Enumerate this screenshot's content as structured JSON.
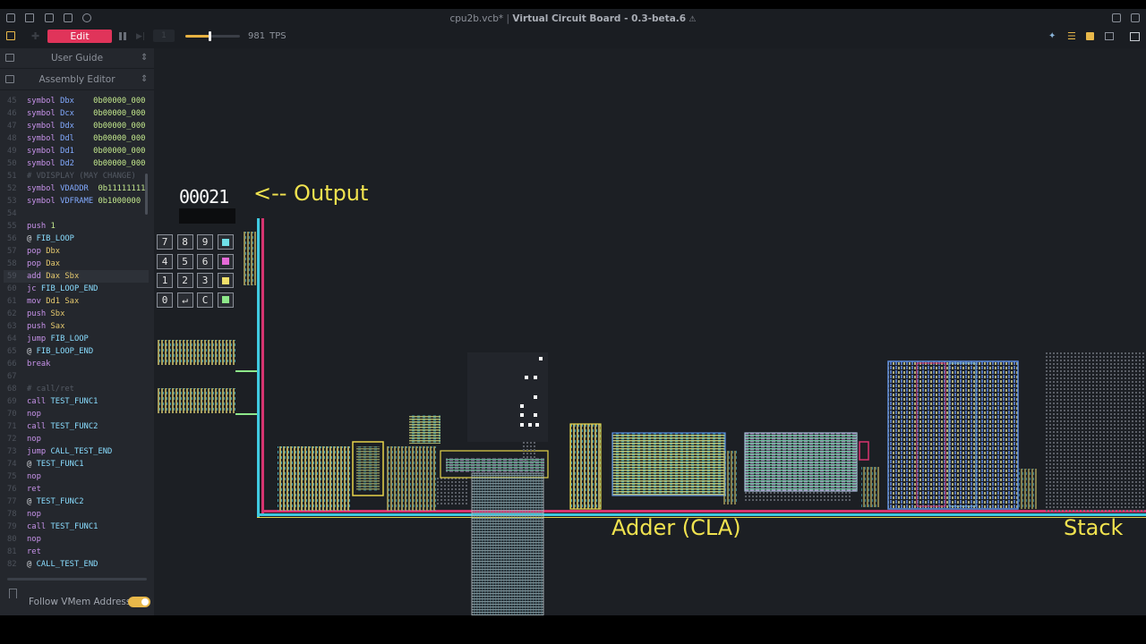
{
  "window": {
    "title_file": "cpu2b.vcb*",
    "title_app": "Virtual Circuit Board - 0.3-beta.6"
  },
  "toolbar": {
    "mode_label": "Edit",
    "step_value": "1",
    "speed_level": 0.45,
    "tps_value": "981",
    "tps_unit": "TPS"
  },
  "sidebar": {
    "panels": [
      {
        "label": "User Guide"
      },
      {
        "label": "Assembly Editor"
      }
    ],
    "code_lines": [
      {
        "n": "45",
        "parts": [
          {
            "t": "symbol ",
            "c": "t-kw"
          },
          {
            "t": "Dbx",
            "c": "t-sym"
          },
          {
            "t": "    0b00000_000",
            "c": "t-num"
          }
        ]
      },
      {
        "n": "46",
        "parts": [
          {
            "t": "symbol ",
            "c": "t-kw"
          },
          {
            "t": "Dcx",
            "c": "t-sym"
          },
          {
            "t": "    0b00000_000",
            "c": "t-num"
          }
        ]
      },
      {
        "n": "47",
        "parts": [
          {
            "t": "symbol ",
            "c": "t-kw"
          },
          {
            "t": "Ddx",
            "c": "t-sym"
          },
          {
            "t": "    0b00000_000",
            "c": "t-num"
          }
        ]
      },
      {
        "n": "48",
        "parts": [
          {
            "t": "symbol ",
            "c": "t-kw"
          },
          {
            "t": "Ddl",
            "c": "t-sym"
          },
          {
            "t": "    0b00000_000",
            "c": "t-num"
          }
        ]
      },
      {
        "n": "49",
        "parts": [
          {
            "t": "symbol ",
            "c": "t-kw"
          },
          {
            "t": "Dd1",
            "c": "t-sym"
          },
          {
            "t": "    0b00000_000",
            "c": "t-num"
          }
        ]
      },
      {
        "n": "50",
        "parts": [
          {
            "t": "symbol ",
            "c": "t-kw"
          },
          {
            "t": "Dd2",
            "c": "t-sym"
          },
          {
            "t": "    0b00000_000",
            "c": "t-num"
          }
        ]
      },
      {
        "n": "51",
        "parts": [
          {
            "t": "# VDISPLAY (MAY CHANGE)",
            "c": "t-cmt"
          }
        ]
      },
      {
        "n": "52",
        "parts": [
          {
            "t": "symbol ",
            "c": "t-kw"
          },
          {
            "t": "VDADDR",
            "c": "t-sym"
          },
          {
            "t": "  0b11111111",
            "c": "t-num"
          }
        ]
      },
      {
        "n": "53",
        "parts": [
          {
            "t": "symbol ",
            "c": "t-kw"
          },
          {
            "t": "VDFRAME",
            "c": "t-sym"
          },
          {
            "t": " 0b1000000",
            "c": "t-num"
          }
        ]
      },
      {
        "n": "54",
        "parts": []
      },
      {
        "n": "55",
        "parts": [
          {
            "t": "push ",
            "c": "t-kw"
          },
          {
            "t": "1",
            "c": "t-num"
          }
        ]
      },
      {
        "n": "56",
        "parts": [
          {
            "t": "@ ",
            "c": "t-txt"
          },
          {
            "t": "FIB_LOOP",
            "c": "t-lbl"
          }
        ]
      },
      {
        "n": "57",
        "parts": [
          {
            "t": "pop ",
            "c": "t-kw"
          },
          {
            "t": "Dbx",
            "c": "t-id"
          }
        ]
      },
      {
        "n": "58",
        "parts": [
          {
            "t": "pop ",
            "c": "t-kw"
          },
          {
            "t": "Dax",
            "c": "t-id"
          }
        ]
      },
      {
        "n": "59",
        "hl": true,
        "parts": [
          {
            "t": "add ",
            "c": "t-kw"
          },
          {
            "t": "Dax Sbx",
            "c": "t-id"
          }
        ]
      },
      {
        "n": "60",
        "parts": [
          {
            "t": "jc ",
            "c": "t-kw"
          },
          {
            "t": "FIB_LOOP_END",
            "c": "t-lbl"
          }
        ]
      },
      {
        "n": "61",
        "parts": [
          {
            "t": "mov ",
            "c": "t-kw"
          },
          {
            "t": "Dd1 Sax",
            "c": "t-id"
          }
        ]
      },
      {
        "n": "62",
        "parts": [
          {
            "t": "push ",
            "c": "t-kw"
          },
          {
            "t": "Sbx",
            "c": "t-id"
          }
        ]
      },
      {
        "n": "63",
        "parts": [
          {
            "t": "push ",
            "c": "t-kw"
          },
          {
            "t": "Sax",
            "c": "t-id"
          }
        ]
      },
      {
        "n": "64",
        "parts": [
          {
            "t": "jump ",
            "c": "t-kw"
          },
          {
            "t": "FIB_LOOP",
            "c": "t-lbl"
          }
        ]
      },
      {
        "n": "65",
        "parts": [
          {
            "t": "@ ",
            "c": "t-txt"
          },
          {
            "t": "FIB_LOOP_END",
            "c": "t-lbl"
          }
        ]
      },
      {
        "n": "66",
        "parts": [
          {
            "t": "break",
            "c": "t-kw"
          }
        ]
      },
      {
        "n": "67",
        "parts": []
      },
      {
        "n": "68",
        "parts": [
          {
            "t": "# call/ret",
            "c": "t-cmt"
          }
        ]
      },
      {
        "n": "69",
        "parts": [
          {
            "t": "call ",
            "c": "t-kw"
          },
          {
            "t": "TEST_FUNC1",
            "c": "t-lbl"
          }
        ]
      },
      {
        "n": "70",
        "parts": [
          {
            "t": "nop",
            "c": "t-kw"
          }
        ]
      },
      {
        "n": "71",
        "parts": [
          {
            "t": "call ",
            "c": "t-kw"
          },
          {
            "t": "TEST_FUNC2",
            "c": "t-lbl"
          }
        ]
      },
      {
        "n": "72",
        "parts": [
          {
            "t": "nop",
            "c": "t-kw"
          }
        ]
      },
      {
        "n": "73",
        "parts": [
          {
            "t": "jump ",
            "c": "t-kw"
          },
          {
            "t": "CALL_TEST_END",
            "c": "t-lbl"
          }
        ]
      },
      {
        "n": "74",
        "parts": [
          {
            "t": "@ ",
            "c": "t-txt"
          },
          {
            "t": "TEST_FUNC1",
            "c": "t-lbl"
          }
        ]
      },
      {
        "n": "75",
        "parts": [
          {
            "t": "nop",
            "c": "t-kw"
          }
        ]
      },
      {
        "n": "76",
        "parts": [
          {
            "t": "ret",
            "c": "t-kw"
          }
        ]
      },
      {
        "n": "77",
        "parts": [
          {
            "t": "@ ",
            "c": "t-txt"
          },
          {
            "t": "TEST_FUNC2",
            "c": "t-lbl"
          }
        ]
      },
      {
        "n": "78",
        "parts": [
          {
            "t": "nop",
            "c": "t-kw"
          }
        ]
      },
      {
        "n": "79",
        "parts": [
          {
            "t": "call ",
            "c": "t-kw"
          },
          {
            "t": "TEST_FUNC1",
            "c": "t-lbl"
          }
        ]
      },
      {
        "n": "80",
        "parts": [
          {
            "t": "nop",
            "c": "t-kw"
          }
        ]
      },
      {
        "n": "81",
        "parts": [
          {
            "t": "ret",
            "c": "t-kw"
          }
        ]
      },
      {
        "n": "82",
        "parts": [
          {
            "t": "@ ",
            "c": "t-txt"
          },
          {
            "t": "CALL_TEST_END",
            "c": "t-lbl"
          }
        ]
      }
    ],
    "follow_label": "Follow VMem Address",
    "follow_enabled": true
  },
  "canvas": {
    "display_value": "00021",
    "output_label": "<-- Output",
    "adder_label": "Adder (CLA)",
    "stack_label": "Stack",
    "keypad_keys": [
      "7",
      "8",
      "9",
      "4",
      "5",
      "6",
      "1",
      "2",
      "3",
      "0",
      "↵",
      "C"
    ],
    "keypad_colors": [
      "#6fe0e8",
      "#e66ad8",
      "#f2e06a",
      "#8ee88a"
    ],
    "colors": {
      "wire_cyan": "#3fc9e0",
      "wire_magenta": "#d8336f",
      "wire_yellow": "#e6d44a",
      "accent_red": "#e0345a",
      "accent_gold": "#e8b84a"
    }
  }
}
